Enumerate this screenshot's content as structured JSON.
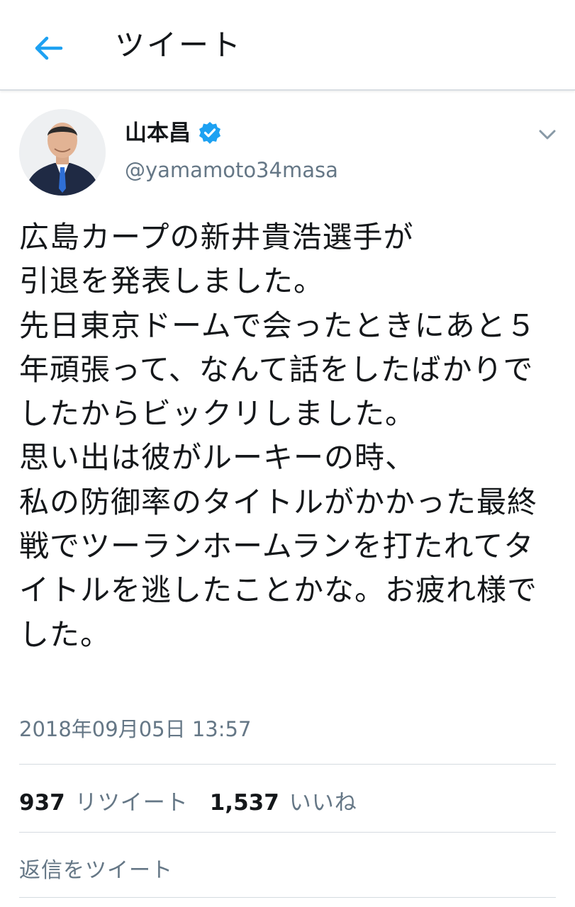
{
  "header": {
    "title": "ツイート",
    "back_icon": "arrow-left-icon"
  },
  "tweet": {
    "author": {
      "display_name": "山本昌",
      "handle": "@yamamoto34masa",
      "verified": true,
      "verified_icon": "verified-badge-icon"
    },
    "text": "広島カープの新井貴浩選手が\n引退を発表しました。\n先日東京ドームで会ったときにあと５年頑張って、なんて話をしたばかりでしたからビックリしました。\n思い出は彼がルーキーの時、\n私の防御率のタイトルがかかった最終戦でツーランホームランを打たれてタイトルを逃したことかな。お疲れ様でした。",
    "timestamp": "2018年09月05日 13:57",
    "menu_icon": "chevron-down-icon"
  },
  "stats": {
    "retweets": {
      "count": "937",
      "label": "リツイート"
    },
    "likes": {
      "count": "1,537",
      "label": "いいね"
    }
  },
  "reply": {
    "placeholder": "返信をツイート"
  },
  "colors": {
    "accent": "#1da1f2",
    "text_primary": "#14171a",
    "text_secondary": "#657786",
    "divider": "#d5dbe0"
  }
}
